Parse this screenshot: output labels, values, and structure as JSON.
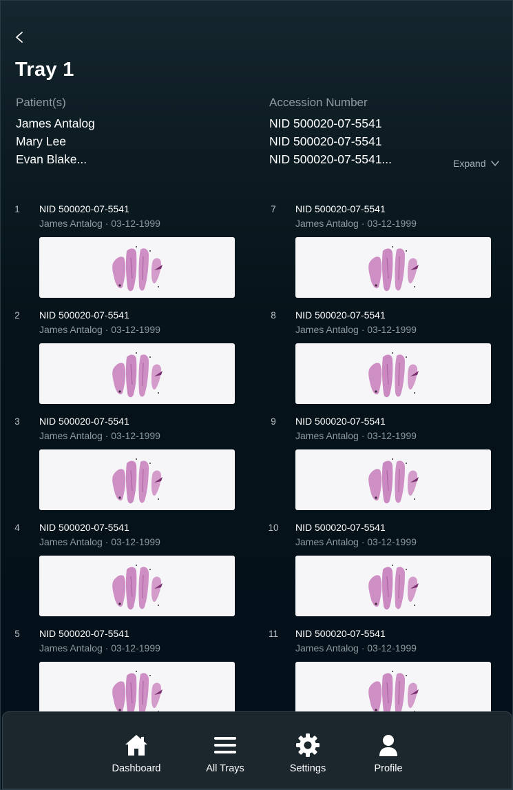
{
  "header": {
    "title": "Tray 1",
    "back_icon": "chevron-left-icon"
  },
  "patients": {
    "label": "Patient(s)",
    "items": [
      "James Antalog",
      "Mary Lee",
      "Evan Blake..."
    ]
  },
  "accession": {
    "label": "Accession Number",
    "items": [
      "NID 500020-07-5541",
      "NID 500020-07-5541",
      "NID 500020-07-5541..."
    ]
  },
  "expand": {
    "label": "Expand",
    "icon": "chevron-down-icon"
  },
  "slides": [
    {
      "index": "1",
      "accession": "NID 500020-07-5541",
      "meta": "James Antalog · 03-12-1999"
    },
    {
      "index": "2",
      "accession": "NID 500020-07-5541",
      "meta": "James Antalog · 03-12-1999"
    },
    {
      "index": "3",
      "accession": "NID 500020-07-5541",
      "meta": "James Antalog · 03-12-1999"
    },
    {
      "index": "4",
      "accession": "NID 500020-07-5541",
      "meta": "James Antalog · 03-12-1999"
    },
    {
      "index": "5",
      "accession": "NID 500020-07-5541",
      "meta": "James Antalog · 03-12-1999"
    },
    {
      "index": "7",
      "accession": "NID 500020-07-5541",
      "meta": "James Antalog · 03-12-1999"
    },
    {
      "index": "8",
      "accession": "NID 500020-07-5541",
      "meta": "James Antalog · 03-12-1999"
    },
    {
      "index": "9",
      "accession": "NID 500020-07-5541",
      "meta": "James Antalog · 03-12-1999"
    },
    {
      "index": "10",
      "accession": "NID 500020-07-5541",
      "meta": "James Antalog · 03-12-1999"
    },
    {
      "index": "11",
      "accession": "NID 500020-07-5541",
      "meta": "James Antalog · 03-12-1999"
    }
  ],
  "nav": {
    "items": [
      {
        "label": "Dashboard",
        "icon": "home-icon"
      },
      {
        "label": "All Trays",
        "icon": "menu-icon"
      },
      {
        "label": "Settings",
        "icon": "gear-icon"
      },
      {
        "label": "Profile",
        "icon": "user-icon"
      }
    ]
  },
  "colors": {
    "background": "#06131a",
    "nav_background": "#1b262d",
    "muted_text": "#8e9aa1",
    "slide_background": "#f6f5f8",
    "tissue_stain": "#c77dbb"
  }
}
